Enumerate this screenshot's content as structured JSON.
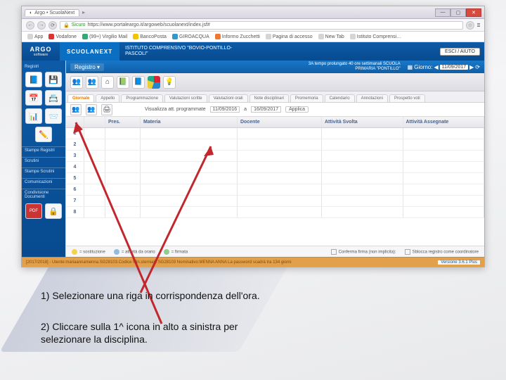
{
  "browser": {
    "tab_title": "Argo • ScuolaNext",
    "secure_label": "Sicuro",
    "url": "https://www.portaleargo.it/argoweb/scuolanext/index.jsf#",
    "bookmarks": [
      "App",
      "Vodafone",
      "(99+) Virgilio Mail",
      "BancoPosta",
      "GIROACQUA",
      "Informo Zucchetti",
      "Pagina di accesso",
      "New Tab",
      "Istituto Comprensi…"
    ]
  },
  "app": {
    "brand": "ARGO",
    "brand_sub": "software",
    "name": "SCUOLANEXT",
    "school_line1": "ISTITUTO COMPRENSIVO \"BOVIO-PONTILLO-",
    "school_line2": "PASCOLI\"",
    "logout": "ESCI / AIUTO"
  },
  "sidebar": {
    "sec_registri": "Registri",
    "sec_stampe": "Stampe Registri",
    "sec_scrutini": "Scrutini",
    "sec_stampe_scr": "Stampe Scrutini",
    "sec_com": "Comunicazioni",
    "sec_cond": "Condivisione Documenti"
  },
  "register": {
    "dropdown": "Registro ▾",
    "class_line1": "3A tempo prolungato 40 ore settimanali SCUOLA",
    "class_line2": "PRIMARIA \"PONTILLO\"",
    "date_label": "Giorno:",
    "date_value": "11/09/2017",
    "tabs": [
      "Giornale",
      "Appello",
      "Programmazione",
      "Valutazioni scritte",
      "Valutazioni orali",
      "Note disciplinari",
      "Promemoria",
      "Calendario",
      "Annotazioni",
      "Prospetto voti"
    ],
    "sub": {
      "filter_label": "Visualizza att. programmate",
      "date_from": "11/09/2016",
      "date_to": "16/09/2017",
      "apply": "Applica"
    },
    "columns": [
      "",
      "",
      "Pres.",
      "Materia",
      "Docente",
      "Attività Svolta",
      "Attività Assegnate"
    ],
    "rows": [
      "1",
      "2",
      "3",
      "4",
      "5",
      "6",
      "7",
      "8"
    ],
    "legend": {
      "sost": "= sostituzione",
      "orar": "= attività da orario",
      "firm": "= firmata",
      "confirm": "Conferma firma (non implicita):",
      "lock": "Sblocca registro come coordinatore"
    }
  },
  "status": {
    "text": "[2017/2018] - Utente:mariaannamenna.SG28103.Codice Min.sterniale:SG28103 Nominativo:MENNA ANNA   La password scadrà tra 134 giorni",
    "version": "Versione 3.6.1 Plus"
  },
  "instructions": {
    "step1": "1)  Selezionare una riga in corrispondenza dell'ora.",
    "step2a": "2) Cliccare sulla 1^ icona in alto a sinistra per",
    "step2b": "selezionare la disciplina."
  },
  "icons": {
    "reg_book": "📘",
    "reg_soft": "💾",
    "cal": "📅",
    "card": "📇",
    "chart": "📊",
    "pen": "✏️",
    "send": "📨",
    "pdf": "PDF",
    "people": "👥",
    "bulb": "💡",
    "book2": "📗",
    "lock": "🔒",
    "print": "🖨",
    "arrow_l": "◀",
    "arrow_r": "▶",
    "home": "⌂",
    "grid": "▦",
    "refresh": "⟳"
  }
}
